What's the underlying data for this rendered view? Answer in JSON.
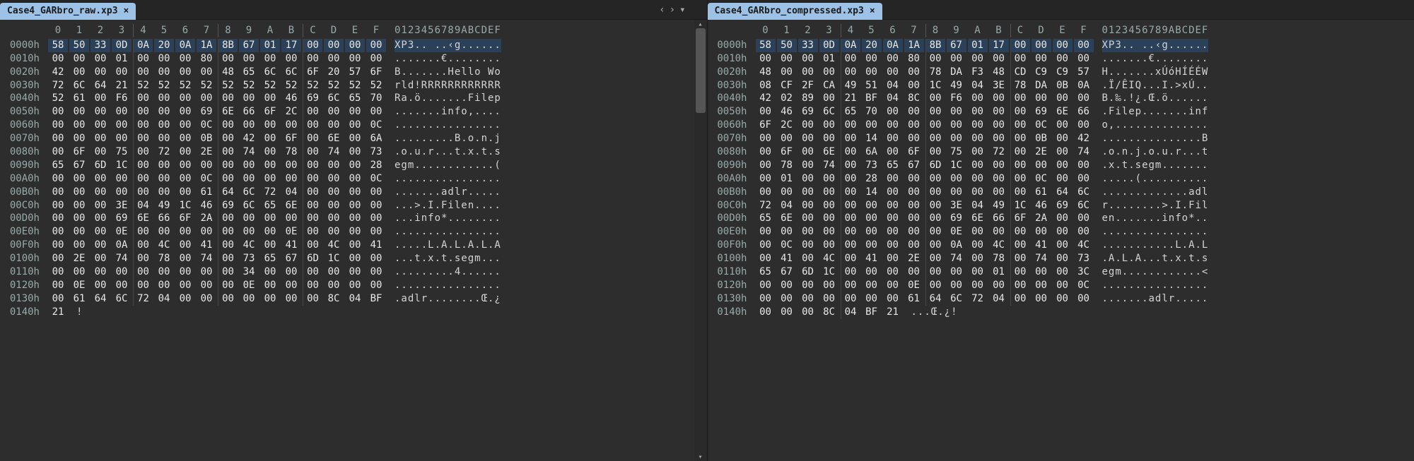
{
  "left": {
    "tab_title": "Case4_GARbro_raw.xp3",
    "close_glyph": "×",
    "controls": [
      "‹",
      "›",
      "▾"
    ],
    "header_hex": [
      "0",
      "1",
      "2",
      "3",
      "4",
      "5",
      "6",
      "7",
      "8",
      "9",
      "A",
      "B",
      "C",
      "D",
      "E",
      "F"
    ],
    "header_ascii": "0123456789ABCDEF",
    "selection_row": 0,
    "rows": [
      {
        "addr": "0000h",
        "bytes": [
          "58",
          "50",
          "33",
          "0D",
          "0A",
          "20",
          "0A",
          "1A",
          "8B",
          "67",
          "01",
          "17",
          "00",
          "00",
          "00",
          "00"
        ],
        "ascii": "XP3.. ..‹g......"
      },
      {
        "addr": "0010h",
        "bytes": [
          "00",
          "00",
          "00",
          "01",
          "00",
          "00",
          "00",
          "80",
          "00",
          "00",
          "00",
          "00",
          "00",
          "00",
          "00",
          "00"
        ],
        "ascii": ".......€........"
      },
      {
        "addr": "0020h",
        "bytes": [
          "42",
          "00",
          "00",
          "00",
          "00",
          "00",
          "00",
          "00",
          "48",
          "65",
          "6C",
          "6C",
          "6F",
          "20",
          "57",
          "6F"
        ],
        "ascii": "B.......Hello Wo"
      },
      {
        "addr": "0030h",
        "bytes": [
          "72",
          "6C",
          "64",
          "21",
          "52",
          "52",
          "52",
          "52",
          "52",
          "52",
          "52",
          "52",
          "52",
          "52",
          "52",
          "52"
        ],
        "ascii": "rld!RRRRRRRRRRRR"
      },
      {
        "addr": "0040h",
        "bytes": [
          "52",
          "61",
          "00",
          "F6",
          "00",
          "00",
          "00",
          "00",
          "00",
          "00",
          "00",
          "46",
          "69",
          "6C",
          "65",
          "70"
        ],
        "ascii": "Ra.ö.......Filep"
      },
      {
        "addr": "0050h",
        "bytes": [
          "00",
          "00",
          "00",
          "00",
          "00",
          "00",
          "00",
          "69",
          "6E",
          "66",
          "6F",
          "2C",
          "00",
          "00",
          "00",
          "00"
        ],
        "ascii": ".......info,...."
      },
      {
        "addr": "0060h",
        "bytes": [
          "00",
          "00",
          "00",
          "00",
          "00",
          "00",
          "00",
          "0C",
          "00",
          "00",
          "00",
          "00",
          "00",
          "00",
          "00",
          "0C"
        ],
        "ascii": "................"
      },
      {
        "addr": "0070h",
        "bytes": [
          "00",
          "00",
          "00",
          "00",
          "00",
          "00",
          "00",
          "0B",
          "00",
          "42",
          "00",
          "6F",
          "00",
          "6E",
          "00",
          "6A"
        ],
        "ascii": ".........B.o.n.j"
      },
      {
        "addr": "0080h",
        "bytes": [
          "00",
          "6F",
          "00",
          "75",
          "00",
          "72",
          "00",
          "2E",
          "00",
          "74",
          "00",
          "78",
          "00",
          "74",
          "00",
          "73"
        ],
        "ascii": ".o.u.r...t.x.t.s"
      },
      {
        "addr": "0090h",
        "bytes": [
          "65",
          "67",
          "6D",
          "1C",
          "00",
          "00",
          "00",
          "00",
          "00",
          "00",
          "00",
          "00",
          "00",
          "00",
          "00",
          "28"
        ],
        "ascii": "egm............("
      },
      {
        "addr": "00A0h",
        "bytes": [
          "00",
          "00",
          "00",
          "00",
          "00",
          "00",
          "00",
          "0C",
          "00",
          "00",
          "00",
          "00",
          "00",
          "00",
          "00",
          "0C"
        ],
        "ascii": "................"
      },
      {
        "addr": "00B0h",
        "bytes": [
          "00",
          "00",
          "00",
          "00",
          "00",
          "00",
          "00",
          "61",
          "64",
          "6C",
          "72",
          "04",
          "00",
          "00",
          "00",
          "00"
        ],
        "ascii": ".......adlr....."
      },
      {
        "addr": "00C0h",
        "bytes": [
          "00",
          "00",
          "00",
          "3E",
          "04",
          "49",
          "1C",
          "46",
          "69",
          "6C",
          "65",
          "6E",
          "00",
          "00",
          "00",
          "00"
        ],
        "ascii": "...>.I.Filen...."
      },
      {
        "addr": "00D0h",
        "bytes": [
          "00",
          "00",
          "00",
          "69",
          "6E",
          "66",
          "6F",
          "2A",
          "00",
          "00",
          "00",
          "00",
          "00",
          "00",
          "00",
          "00"
        ],
        "ascii": "...info*........"
      },
      {
        "addr": "00E0h",
        "bytes": [
          "00",
          "00",
          "00",
          "0E",
          "00",
          "00",
          "00",
          "00",
          "00",
          "00",
          "00",
          "0E",
          "00",
          "00",
          "00",
          "00"
        ],
        "ascii": "................"
      },
      {
        "addr": "00F0h",
        "bytes": [
          "00",
          "00",
          "00",
          "0A",
          "00",
          "4C",
          "00",
          "41",
          "00",
          "4C",
          "00",
          "41",
          "00",
          "4C",
          "00",
          "41"
        ],
        "ascii": ".....L.A.L.A.L.A"
      },
      {
        "addr": "0100h",
        "bytes": [
          "00",
          "2E",
          "00",
          "74",
          "00",
          "78",
          "00",
          "74",
          "00",
          "73",
          "65",
          "67",
          "6D",
          "1C",
          "00",
          "00"
        ],
        "ascii": "...t.x.t.segm..."
      },
      {
        "addr": "0110h",
        "bytes": [
          "00",
          "00",
          "00",
          "00",
          "00",
          "00",
          "00",
          "00",
          "00",
          "34",
          "00",
          "00",
          "00",
          "00",
          "00",
          "00"
        ],
        "ascii": ".........4......"
      },
      {
        "addr": "0120h",
        "bytes": [
          "00",
          "0E",
          "00",
          "00",
          "00",
          "00",
          "00",
          "00",
          "00",
          "0E",
          "00",
          "00",
          "00",
          "00",
          "00",
          "00"
        ],
        "ascii": "................"
      },
      {
        "addr": "0130h",
        "bytes": [
          "00",
          "61",
          "64",
          "6C",
          "72",
          "04",
          "00",
          "00",
          "00",
          "00",
          "00",
          "00",
          "00",
          "8C",
          "04",
          "BF"
        ],
        "ascii": ".adlr........Œ.¿"
      },
      {
        "addr": "0140h",
        "bytes": [
          "21"
        ],
        "ascii": "!"
      }
    ]
  },
  "right": {
    "tab_title": "Case4_GARbro_compressed.xp3",
    "close_glyph": "×",
    "header_hex": [
      "0",
      "1",
      "2",
      "3",
      "4",
      "5",
      "6",
      "7",
      "8",
      "9",
      "A",
      "B",
      "C",
      "D",
      "E",
      "F"
    ],
    "header_ascii": "0123456789ABCDEF",
    "selection_row": 0,
    "rows": [
      {
        "addr": "0000h",
        "bytes": [
          "58",
          "50",
          "33",
          "0D",
          "0A",
          "20",
          "0A",
          "1A",
          "8B",
          "67",
          "01",
          "17",
          "00",
          "00",
          "00",
          "00"
        ],
        "ascii": "XP3.. ..‹g......"
      },
      {
        "addr": "0010h",
        "bytes": [
          "00",
          "00",
          "00",
          "01",
          "00",
          "00",
          "00",
          "80",
          "00",
          "00",
          "00",
          "00",
          "00",
          "00",
          "00",
          "00"
        ],
        "ascii": ".......€........"
      },
      {
        "addr": "0020h",
        "bytes": [
          "48",
          "00",
          "00",
          "00",
          "00",
          "00",
          "00",
          "00",
          "78",
          "DA",
          "F3",
          "48",
          "CD",
          "C9",
          "C9",
          "57"
        ],
        "ascii": "H.......xÚóHÍÉÉW"
      },
      {
        "addr": "0030h",
        "bytes": [
          "08",
          "CF",
          "2F",
          "CA",
          "49",
          "51",
          "04",
          "00",
          "1C",
          "49",
          "04",
          "3E",
          "78",
          "DA",
          "0B",
          "0A"
        ],
        "ascii": ".Ï/ÊIQ...I.>xÚ.."
      },
      {
        "addr": "0040h",
        "bytes": [
          "42",
          "02",
          "89",
          "00",
          "21",
          "BF",
          "04",
          "8C",
          "00",
          "F6",
          "00",
          "00",
          "00",
          "00",
          "00",
          "00"
        ],
        "ascii": "B.‰.!¿.Œ.ö......"
      },
      {
        "addr": "0050h",
        "bytes": [
          "00",
          "46",
          "69",
          "6C",
          "65",
          "70",
          "00",
          "00",
          "00",
          "00",
          "00",
          "00",
          "00",
          "69",
          "6E",
          "66"
        ],
        "ascii": ".Filep.......inf"
      },
      {
        "addr": "0060h",
        "bytes": [
          "6F",
          "2C",
          "00",
          "00",
          "00",
          "00",
          "00",
          "00",
          "00",
          "00",
          "00",
          "00",
          "00",
          "0C",
          "00",
          "00"
        ],
        "ascii": "o,.............."
      },
      {
        "addr": "0070h",
        "bytes": [
          "00",
          "00",
          "00",
          "00",
          "00",
          "14",
          "00",
          "00",
          "00",
          "00",
          "00",
          "00",
          "00",
          "0B",
          "00",
          "42"
        ],
        "ascii": "...............B"
      },
      {
        "addr": "0080h",
        "bytes": [
          "00",
          "6F",
          "00",
          "6E",
          "00",
          "6A",
          "00",
          "6F",
          "00",
          "75",
          "00",
          "72",
          "00",
          "2E",
          "00",
          "74"
        ],
        "ascii": ".o.n.j.o.u.r...t"
      },
      {
        "addr": "0090h",
        "bytes": [
          "00",
          "78",
          "00",
          "74",
          "00",
          "73",
          "65",
          "67",
          "6D",
          "1C",
          "00",
          "00",
          "00",
          "00",
          "00",
          "00"
        ],
        "ascii": ".x.t.segm......."
      },
      {
        "addr": "00A0h",
        "bytes": [
          "00",
          "01",
          "00",
          "00",
          "00",
          "28",
          "00",
          "00",
          "00",
          "00",
          "00",
          "00",
          "00",
          "0C",
          "00",
          "00"
        ],
        "ascii": ".....(.........."
      },
      {
        "addr": "00B0h",
        "bytes": [
          "00",
          "00",
          "00",
          "00",
          "00",
          "14",
          "00",
          "00",
          "00",
          "00",
          "00",
          "00",
          "00",
          "61",
          "64",
          "6C"
        ],
        "ascii": ".............adl"
      },
      {
        "addr": "00C0h",
        "bytes": [
          "72",
          "04",
          "00",
          "00",
          "00",
          "00",
          "00",
          "00",
          "00",
          "3E",
          "04",
          "49",
          "1C",
          "46",
          "69",
          "6C"
        ],
        "ascii": "r........>.I.Fil"
      },
      {
        "addr": "00D0h",
        "bytes": [
          "65",
          "6E",
          "00",
          "00",
          "00",
          "00",
          "00",
          "00",
          "00",
          "69",
          "6E",
          "66",
          "6F",
          "2A",
          "00",
          "00"
        ],
        "ascii": "en.......info*.."
      },
      {
        "addr": "00E0h",
        "bytes": [
          "00",
          "00",
          "00",
          "00",
          "00",
          "00",
          "00",
          "00",
          "00",
          "0E",
          "00",
          "00",
          "00",
          "00",
          "00",
          "00"
        ],
        "ascii": "................"
      },
      {
        "addr": "00F0h",
        "bytes": [
          "00",
          "0C",
          "00",
          "00",
          "00",
          "00",
          "00",
          "00",
          "00",
          "0A",
          "00",
          "4C",
          "00",
          "41",
          "00",
          "4C"
        ],
        "ascii": "...........L.A.L"
      },
      {
        "addr": "0100h",
        "bytes": [
          "00",
          "41",
          "00",
          "4C",
          "00",
          "41",
          "00",
          "2E",
          "00",
          "74",
          "00",
          "78",
          "00",
          "74",
          "00",
          "73"
        ],
        "ascii": ".A.L.A...t.x.t.s"
      },
      {
        "addr": "0110h",
        "bytes": [
          "65",
          "67",
          "6D",
          "1C",
          "00",
          "00",
          "00",
          "00",
          "00",
          "00",
          "00",
          "01",
          "00",
          "00",
          "00",
          "3C"
        ],
        "ascii": "egm............<"
      },
      {
        "addr": "0120h",
        "bytes": [
          "00",
          "00",
          "00",
          "00",
          "00",
          "00",
          "00",
          "0E",
          "00",
          "00",
          "00",
          "00",
          "00",
          "00",
          "00",
          "0C"
        ],
        "ascii": "................"
      },
      {
        "addr": "0130h",
        "bytes": [
          "00",
          "00",
          "00",
          "00",
          "00",
          "00",
          "00",
          "61",
          "64",
          "6C",
          "72",
          "04",
          "00",
          "00",
          "00",
          "00"
        ],
        "ascii": ".......adlr....."
      },
      {
        "addr": "0140h",
        "bytes": [
          "00",
          "00",
          "00",
          "8C",
          "04",
          "BF",
          "21"
        ],
        "ascii": "...Œ.¿!"
      }
    ]
  }
}
